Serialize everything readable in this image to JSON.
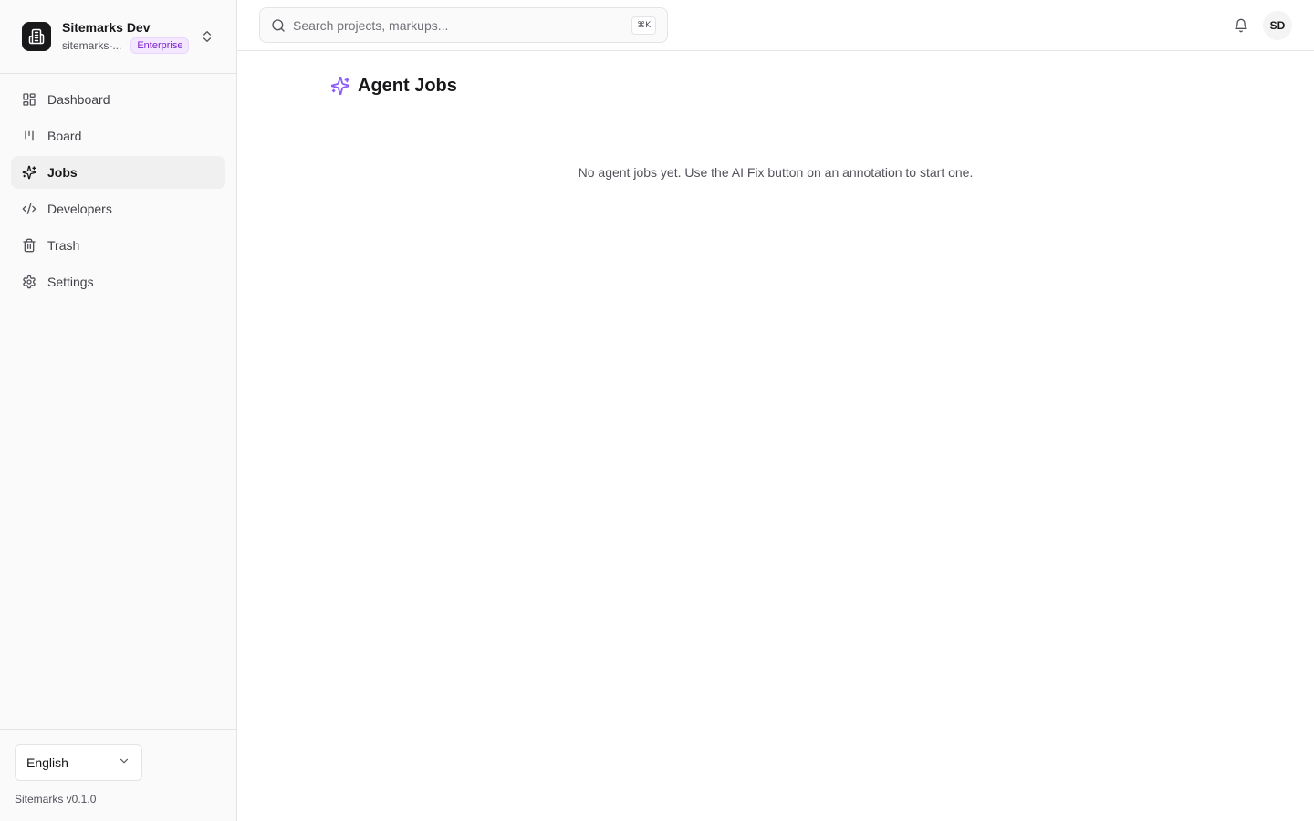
{
  "org": {
    "name": "Sitemarks Dev",
    "slug": "sitemarks-...",
    "plan": "Enterprise",
    "logo_icon": "building-icon",
    "switch_icon": "chevrons-up-down-icon"
  },
  "nav": {
    "items": [
      {
        "label": "Dashboard",
        "icon": "layout-dashboard-icon",
        "active": false
      },
      {
        "label": "Board",
        "icon": "kanban-icon",
        "active": false
      },
      {
        "label": "Jobs",
        "icon": "sparkles-icon",
        "active": true
      },
      {
        "label": "Developers",
        "icon": "code-icon",
        "active": false
      },
      {
        "label": "Trash",
        "icon": "trash-icon",
        "active": false
      },
      {
        "label": "Settings",
        "icon": "settings-icon",
        "active": false
      }
    ]
  },
  "footer": {
    "language": "English",
    "version": "Sitemarks v0.1.0"
  },
  "header": {
    "search_placeholder": "Search projects, markups...",
    "search_shortcut": "⌘K",
    "avatar_initials": "SD"
  },
  "page": {
    "title": "Agent Jobs",
    "empty_message": "No agent jobs yet. Use the AI Fix button on an annotation to start one."
  },
  "colors": {
    "accent": "#8b5cf6",
    "active_bg": "#f0f0f1",
    "badge_text": "#7e22ce",
    "badge_bg": "#f3e8ff"
  }
}
